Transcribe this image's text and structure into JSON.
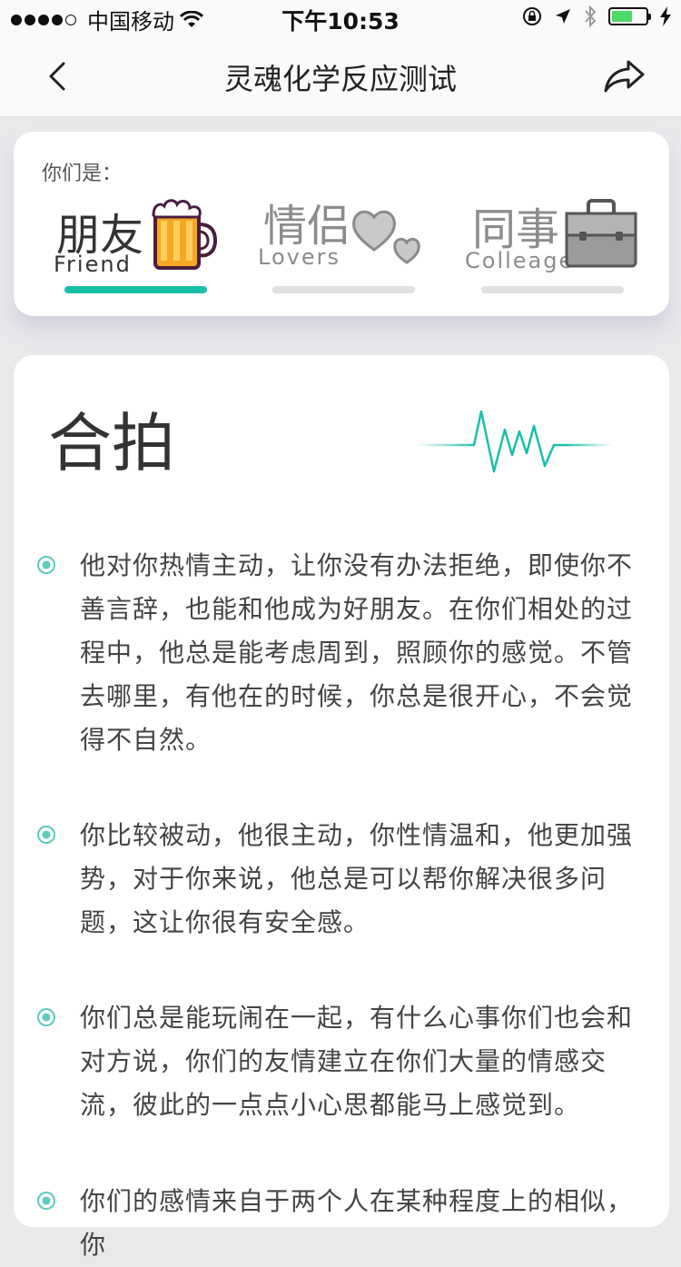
{
  "status_bar": {
    "carrier": "中国移动",
    "time": "下午10:53"
  },
  "nav": {
    "title": "灵魂化学反应测试",
    "back_icon": "chevron-left-icon",
    "share_icon": "share-arrow-icon"
  },
  "category": {
    "heading": "你们是：",
    "tabs": [
      {
        "zh": "朋友",
        "en": "Friend",
        "active": true,
        "icon": "beer-mug-icon"
      },
      {
        "zh": "情侣",
        "en": "Lovers",
        "active": false,
        "icon": "hearts-icon"
      },
      {
        "zh": "同事",
        "en": "Colleage",
        "active": false,
        "icon": "briefcase-icon"
      }
    ]
  },
  "content": {
    "title": "合拍",
    "items": [
      "他对你热情主动，让你没有办法拒绝，即使你不善言辞，也能和他成为好朋友。在你们相处的过程中，他总是能考虑周到，照顾你的感觉。不管去哪里，有他在的时候，你总是很开心，不会觉得不自然。",
      "你比较被动，他很主动，你性情温和，他更加强势，对于你来说，他总是可以帮你解决很多问题，这让你很有安全感。",
      "你们总是能玩闹在一起，有什么心事你们也会和对方说，你们的友情建立在你们大量的情感交流，彼此的一点点小心思都能马上感觉到。",
      "你们的感情来自于两个人在某种程度上的相似，你"
    ]
  },
  "colors": {
    "accent": "#19bfa9",
    "inactive": "#8c8c8c",
    "beer": "#f5a623"
  }
}
